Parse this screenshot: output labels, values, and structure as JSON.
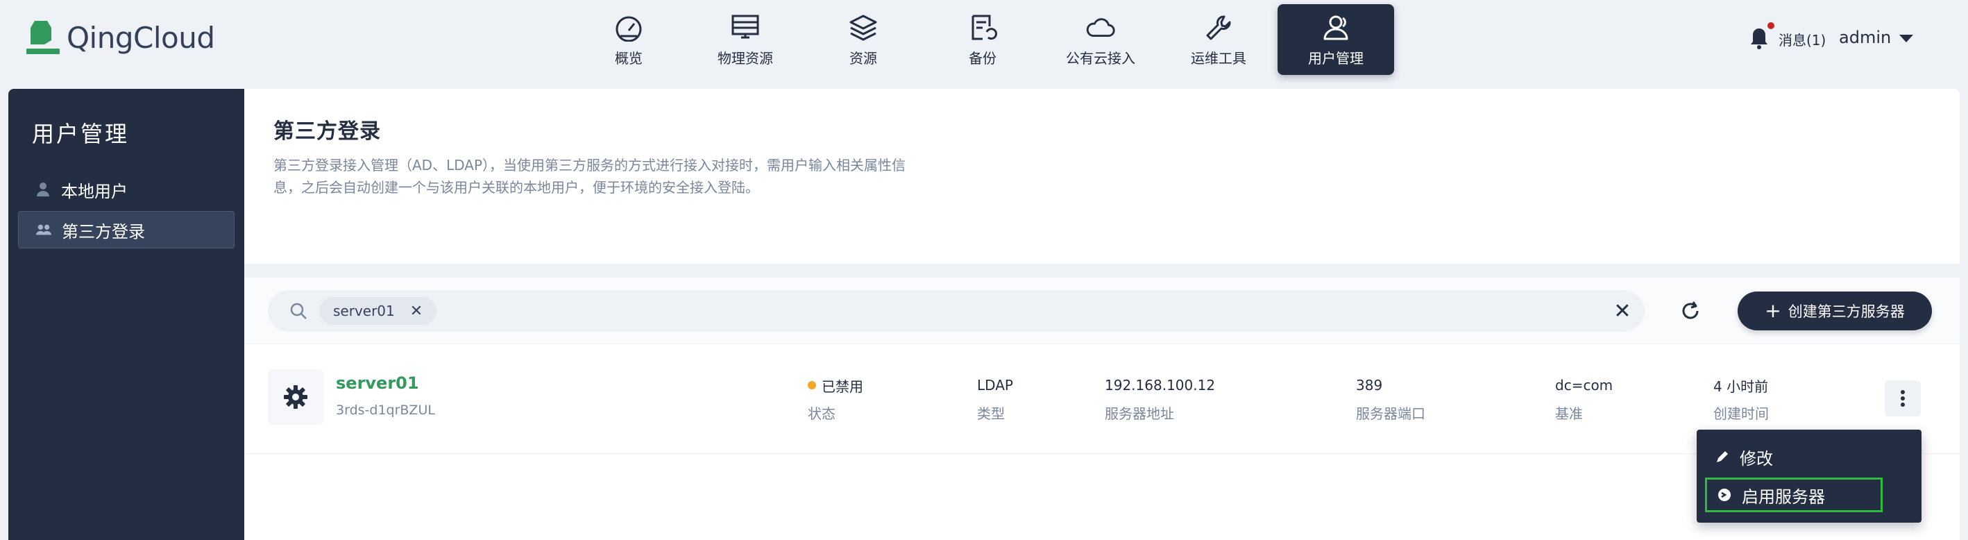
{
  "brand": {
    "name": "QingCloud",
    "color": "#329a5c"
  },
  "nav": [
    {
      "label": "概览",
      "icon": "dashboard-icon"
    },
    {
      "label": "物理资源",
      "icon": "server-icon"
    },
    {
      "label": "资源",
      "icon": "layers-icon"
    },
    {
      "label": "备份",
      "icon": "backup-icon"
    },
    {
      "label": "公有云接入",
      "icon": "cloud-icon"
    },
    {
      "label": "运维工具",
      "icon": "wrench-icon"
    },
    {
      "label": "用户管理",
      "icon": "users-icon",
      "active": true
    }
  ],
  "topright": {
    "messages": "消息(1)",
    "user": "admin"
  },
  "sidebar": {
    "title": "用户管理",
    "items": [
      {
        "label": "本地用户",
        "icon": "user-icon"
      },
      {
        "label": "第三方登录",
        "icon": "group-icon",
        "active": true
      }
    ]
  },
  "header": {
    "title": "第三方登录",
    "desc_line1": "第三方登录接入管理（AD、LDAP），当使用第三方服务的方式进行接入对接时，需用户输入相关属性信",
    "desc_line2": "息，之后会自动创建一个与该用户关联的本地用户，便于环境的安全接入登陆。"
  },
  "toolbar": {
    "search_tag": "server01",
    "create_label": "创建第三方服务器"
  },
  "row": {
    "name": "server01",
    "id": "3rds-d1qrBZUL",
    "status_value": "已禁用",
    "status_key": "状态",
    "status_color": "#f5a623",
    "type_value": "LDAP",
    "type_key": "类型",
    "addr_value": "192.168.100.12",
    "addr_key": "服务器地址",
    "port_value": "389",
    "port_key": "服务器端口",
    "base_value": "dc=com",
    "base_key": "基准",
    "time_value": "4 小时前",
    "time_key": "创建时间"
  },
  "menu": {
    "edit": "修改",
    "enable": "启用服务器"
  }
}
